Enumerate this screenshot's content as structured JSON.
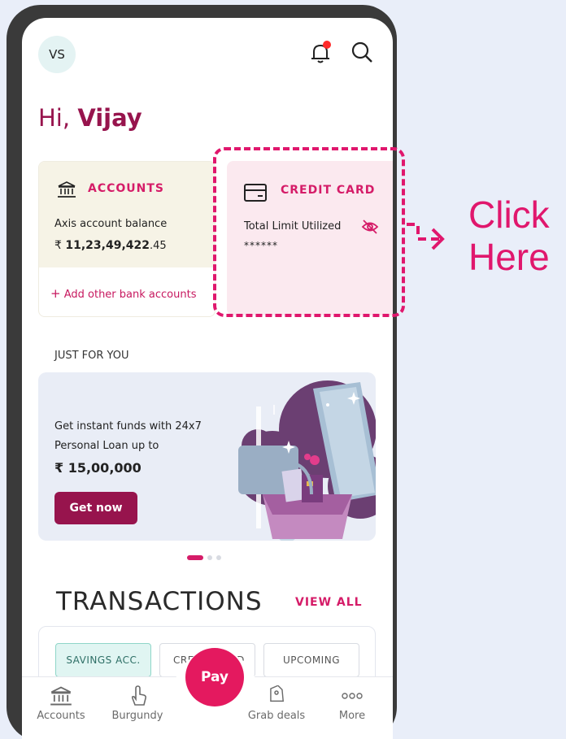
{
  "header": {
    "avatar_initials": "VS",
    "greeting_prefix": "Hi,",
    "greeting_name": "Vijay"
  },
  "accounts_card": {
    "title": "ACCOUNTS",
    "label": "Axis account balance",
    "currency": "₹",
    "balance_main": "11,23,49,422",
    "balance_decimal": ".45",
    "add_link": "Add other bank accounts"
  },
  "credit_card": {
    "title": "CREDIT CARD",
    "label": "Total Limit Utilized",
    "masked_value": "******"
  },
  "just_for_you": {
    "heading": "JUST FOR YOU",
    "promo_text": "Get instant funds with 24x7 Personal Loan up to",
    "promo_amount": "₹ 15,00,000",
    "cta": "Get now",
    "carousel": {
      "count": 3,
      "active_index": 0
    }
  },
  "transactions": {
    "title": "TRANSACTIONS",
    "view_all": "VIEW ALL",
    "chips": [
      "SAVINGS ACC.",
      "CREDIT CARD",
      "UPCOMING"
    ]
  },
  "tab_bar": {
    "accounts": "Accounts",
    "burgundy": "Burgundy",
    "pay": "Pay",
    "grab_deals": "Grab deals",
    "more": "More"
  },
  "callout": {
    "line1": "Click",
    "line2": "Here"
  },
  "colors": {
    "brand": "#97144d",
    "accent": "#e0176d",
    "notification_dot": "#ff2a2a"
  }
}
